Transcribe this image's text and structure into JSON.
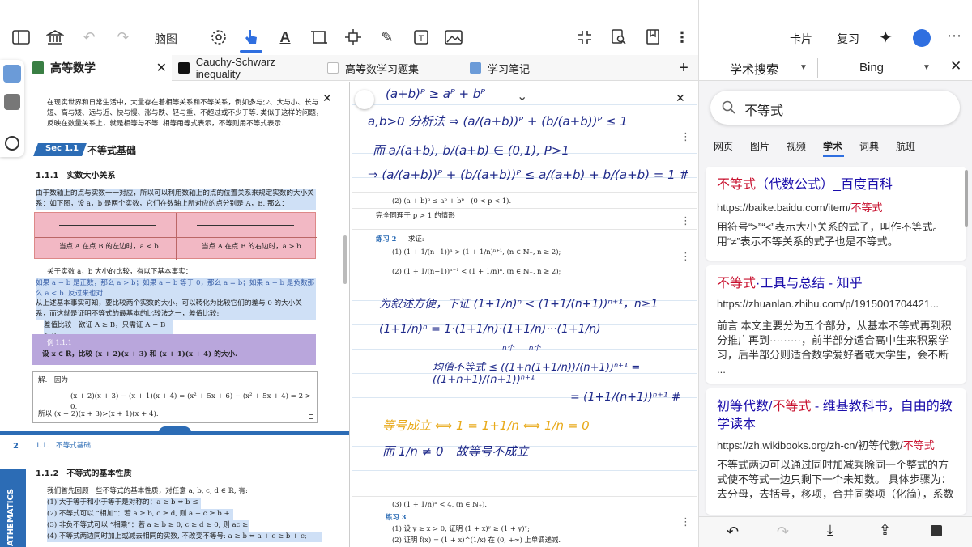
{
  "toolbar": {
    "mindmap_label": "脑图",
    "card_label": "卡片",
    "review_label": "复习"
  },
  "tabs": [
    {
      "label": "高等数学",
      "active": true
    },
    {
      "label": "Cauchy-Schwarz inequality",
      "active": false
    },
    {
      "label": "高等数学习题集",
      "active": false
    },
    {
      "label": "学习笔记",
      "active": false
    }
  ],
  "leftdoc": {
    "intro": "在现实世界和日常生活中，大量存在着相等关系和不等关系，例如多与少、大与小、长与短、高与矮、远与近、快与慢、涨与跌、轻与重、不超过或不少于等. 类似于这样的问题，反映在数量关系上，就是相等与不等. 相等用等式表示，不等则用不等式表示.",
    "sec_tag": "Sec 1.1",
    "sec_title": "不等式基础",
    "sub1": "1.1.1　实数大小关系",
    "p1": "由于数轴上的点与实数一一对应，所以可以利用数轴上的点的位置关系来规定实数的大小关系：如下图，设 a，b 是两个实数，它们在数轴上所对应的点分别是 A，B. 那么：",
    "cell_left": "当点 A 在点 B 的左边时，a < b",
    "cell_right": "当点 A 在点 B 的右边时，a > b",
    "p2": "关于实数 a，b 大小的比较，有以下基本事实：",
    "p3": "如果 a − b 是正数，那么 a > b；如果 a − b 等于 0，那么 a = b；如果 a − b 是负数那么 a < b. 反过来也对.",
    "p4": "从上述基本事实可知，要比较两个实数的大小，可以转化为比较它们的差与 0 的大小关系，而这就是证明不等式的最基本的比较法之一，差值比较:",
    "p5": "差值比较　欲证 A ≥ B，只需证 A − B ≥ 0.",
    "example_tag": "例 1.1.1",
    "example": "设 x ∈ ℝ，比较 (x + 2)(x + 3) 和 (x + 1)(x + 4) 的大小.",
    "sol_label": "解.　因为",
    "sol_eq": "(x + 2)(x + 3) − (x + 1)(x + 4) = (x² + 5x + 6) − (x² + 5x + 4) = 2 > 0,",
    "sol_end": "所以 (x + 2)(x + 3)>(x + 1)(x + 4).",
    "page_num": "2",
    "running_head": "1.1.　不等式基础",
    "sub2": "1.1.2　不等式的基本性质",
    "p6": "我们首先回顾一些不等式的基本性质，对任意 a, b, c, d ∈ ℝ, 有:",
    "props": [
      "(1) 大于等于和小于等于是对称的：a ≥ b ⇔ b ≤ a;",
      "(2) 不等式可以 “相加”：若 a ≥ b, c ≥ d, 则 a + c ≥ b + d;",
      "(3) 非负不等式可以 “相乘”：若 a ≥ b ≥ 0, c ≥ d ≥ 0, 则 ac ≥ bd;",
      "(4) 不等式两边同时加上或减去相同的实数, 不改变不等号: a ≥ b ⇔ a + c ≥ b + c;"
    ],
    "side_label": "ATHEMATICS"
  },
  "notes": {
    "hw1": "(a+b)ᴾ ≥ aᴾ + bᴾ",
    "hw2": "a,b>0 分析法 ⇒ (a/(a+b))ᴾ + (b/(a+b))ᴾ ≤ 1",
    "hw3": "而 a/(a+b), b/(a+b) ∈ (0,1), P>1",
    "hw4": "⇒ (a/(a+b))ᴾ + (b/(a+b))ᴾ ≤ a/(a+b) + b/(a+b) = 1 #",
    "q2": "(2) (a + b)ᵖ ≤ aᵖ + bᵖ　(0 < p < 1).",
    "same": "完全同理于 p > 1 的情形",
    "ex2_label": "练习 2",
    "ex2_title": "求证:",
    "ex2_1": "(1) (1 + 1/(n−1))ⁿ > (1 + 1/n)ⁿ⁺¹, (n ∈ ℕ₊, n ≥ 2);",
    "ex2_2": "(2) (1 + 1/(n−1))ⁿ⁻¹ < (1 + 1/n)ⁿ, (n ∈ ℕ₊, n ≥ 2);",
    "hw5": "为叙述方便，下证 (1+1/n)ⁿ < (1+1/(n+1))ⁿ⁺¹，n≥1",
    "hw6": "(1+1/n)ⁿ = 1·(1+1/n)·(1+1/n)···(1+1/n)",
    "hw6b": "n个　　n个",
    "hw7": "均值不等式 ≤ ((1+n(1+1/n))/(n+1))ⁿ⁺¹ = ((1+n+1)/(n+1))ⁿ⁺¹",
    "hw8": "= (1+1/(n+1))ⁿ⁺¹ #",
    "hw9": "等号成立 ⟺ 1 = 1+1/n ⟺ 1/n = 0",
    "hw10": "而 1/n ≠ 0　故等号不成立",
    "q3": "(3) (1 + 1/n)ⁿ < 4, (n ∈ ℕ₊).",
    "ex3_label": "练习 3",
    "ex3_1": "(1) 设 y ≥ x > 0, 证明 (1 + x)ʸ ≥ (1 + y)ˣ;",
    "ex3_2": "(2) 证明 f(x) = (1 + x)^(1/x) 在 (0, +∞) 上单调递减."
  },
  "sidebar": {
    "tab_scholar": "学术搜索",
    "tab_bing": "Bing",
    "search_value": "不等式",
    "filters": [
      "网页",
      "图片",
      "视频",
      "学术",
      "词典",
      "航班"
    ],
    "active_filter": "学术",
    "results": [
      {
        "title_pre": "",
        "title_hl": "不等式",
        "title_post": "（代数公式）_百度百科",
        "url_pre": "https://baike.baidu.com/item/",
        "url_hl": "不等式",
        "snippet": "用符号“>”“<”表示大小关系的式子，叫作不等式。用“≠”表示不等关系的式子也是不等式。"
      },
      {
        "title_pre": "",
        "title_hl": "不等式",
        "title_post": "·工具与总结 - 知乎",
        "url_pre": "https://zhuanlan.zhihu.com/p/1915001704421...",
        "url_hl": "",
        "snippet": "前言 本文主要分为五个部分，从基本不等式再到积分推广再到·········，前半部分适合高中生来积累学习，后半部分则适合数学爱好者或大学生，会不断 ..."
      },
      {
        "title_pre": "初等代数/",
        "title_hl": "不等式",
        "title_post": " - 维基教科书，自由的教学读本",
        "url_pre": "https://zh.wikibooks.org/zh-cn/初等代數/",
        "url_hl": "不等式",
        "snippet": "不等式两边可以通过同时加减乘除同一个整式的方式使不等式一边只剩下一个未知数。 具体步骤为：去分母，去括号，移项，合并同类项（化简），系数 ..."
      }
    ]
  },
  "colors": {
    "accent": "#2f6fe0",
    "link": "#1a0dab",
    "highlight_red": "#c8102e",
    "hl_blue": "#cfe0f6",
    "hl_pink": "#f2b8c4",
    "hl_purple": "#b9a6dc",
    "handwriting_blue": "#1f2a8a",
    "handwriting_yellow": "#e8a918"
  }
}
